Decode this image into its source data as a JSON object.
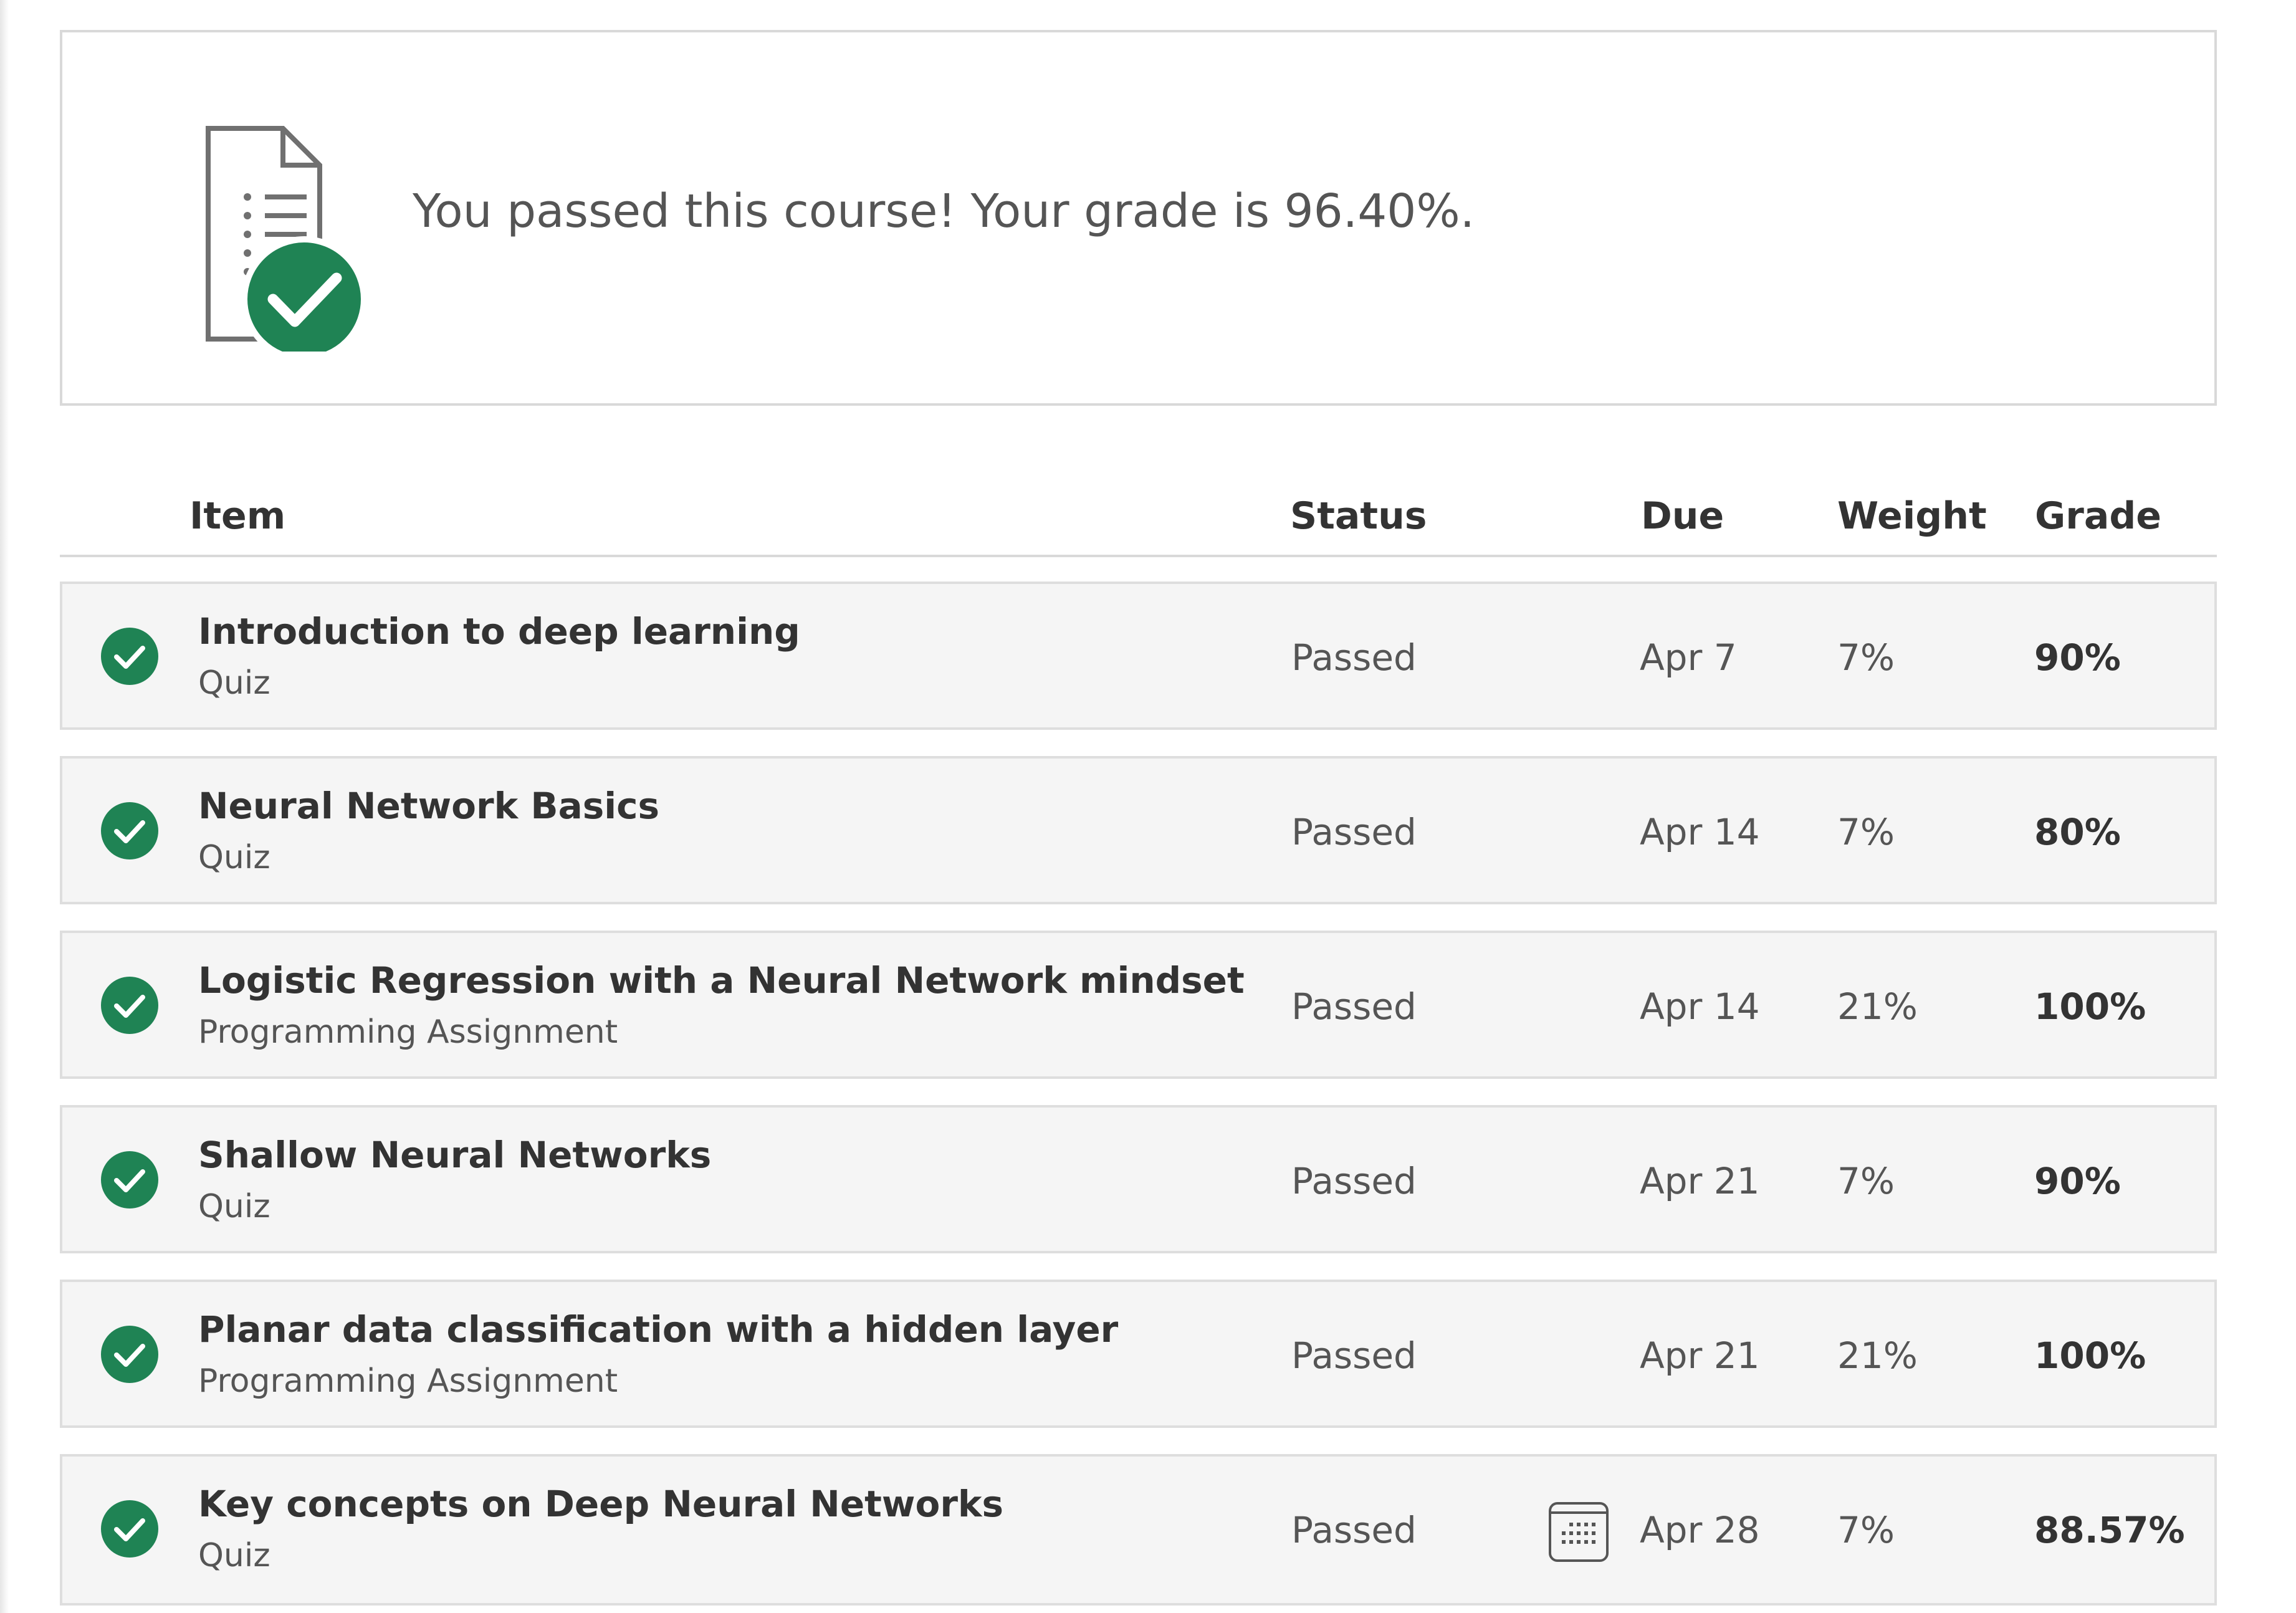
{
  "summary": {
    "message": "You passed this course! Your grade is 96.40%.",
    "icon": "document-check-icon",
    "accent_color": "#1f8354"
  },
  "table": {
    "headers": {
      "item": "Item",
      "status": "Status",
      "due": "Due",
      "weight": "Weight",
      "grade": "Grade"
    },
    "rows": [
      {
        "title": "Introduction to deep learning",
        "type": "Quiz",
        "status": "Passed",
        "due": "Apr 7",
        "weight": "7%",
        "grade": "90%"
      },
      {
        "title": "Neural Network Basics",
        "type": "Quiz",
        "status": "Passed",
        "due": "Apr 14",
        "weight": "7%",
        "grade": "80%"
      },
      {
        "title": "Logistic Regression with a Neural Network mindset",
        "type": "Programming Assignment",
        "status": "Passed",
        "due": "Apr 14",
        "weight": "21%",
        "grade": "100%"
      },
      {
        "title": "Shallow Neural Networks",
        "type": "Quiz",
        "status": "Passed",
        "due": "Apr 21",
        "weight": "7%",
        "grade": "90%"
      },
      {
        "title": "Planar data classification with a hidden layer",
        "type": "Programming Assignment",
        "status": "Passed",
        "due": "Apr 21",
        "weight": "21%",
        "grade": "100%"
      },
      {
        "title": "Key concepts on Deep Neural Networks",
        "type": "Quiz",
        "status": "Passed",
        "due": "Apr 28",
        "weight": "7%",
        "grade": "88.57%",
        "due_icon": "calendar-icon"
      }
    ]
  }
}
